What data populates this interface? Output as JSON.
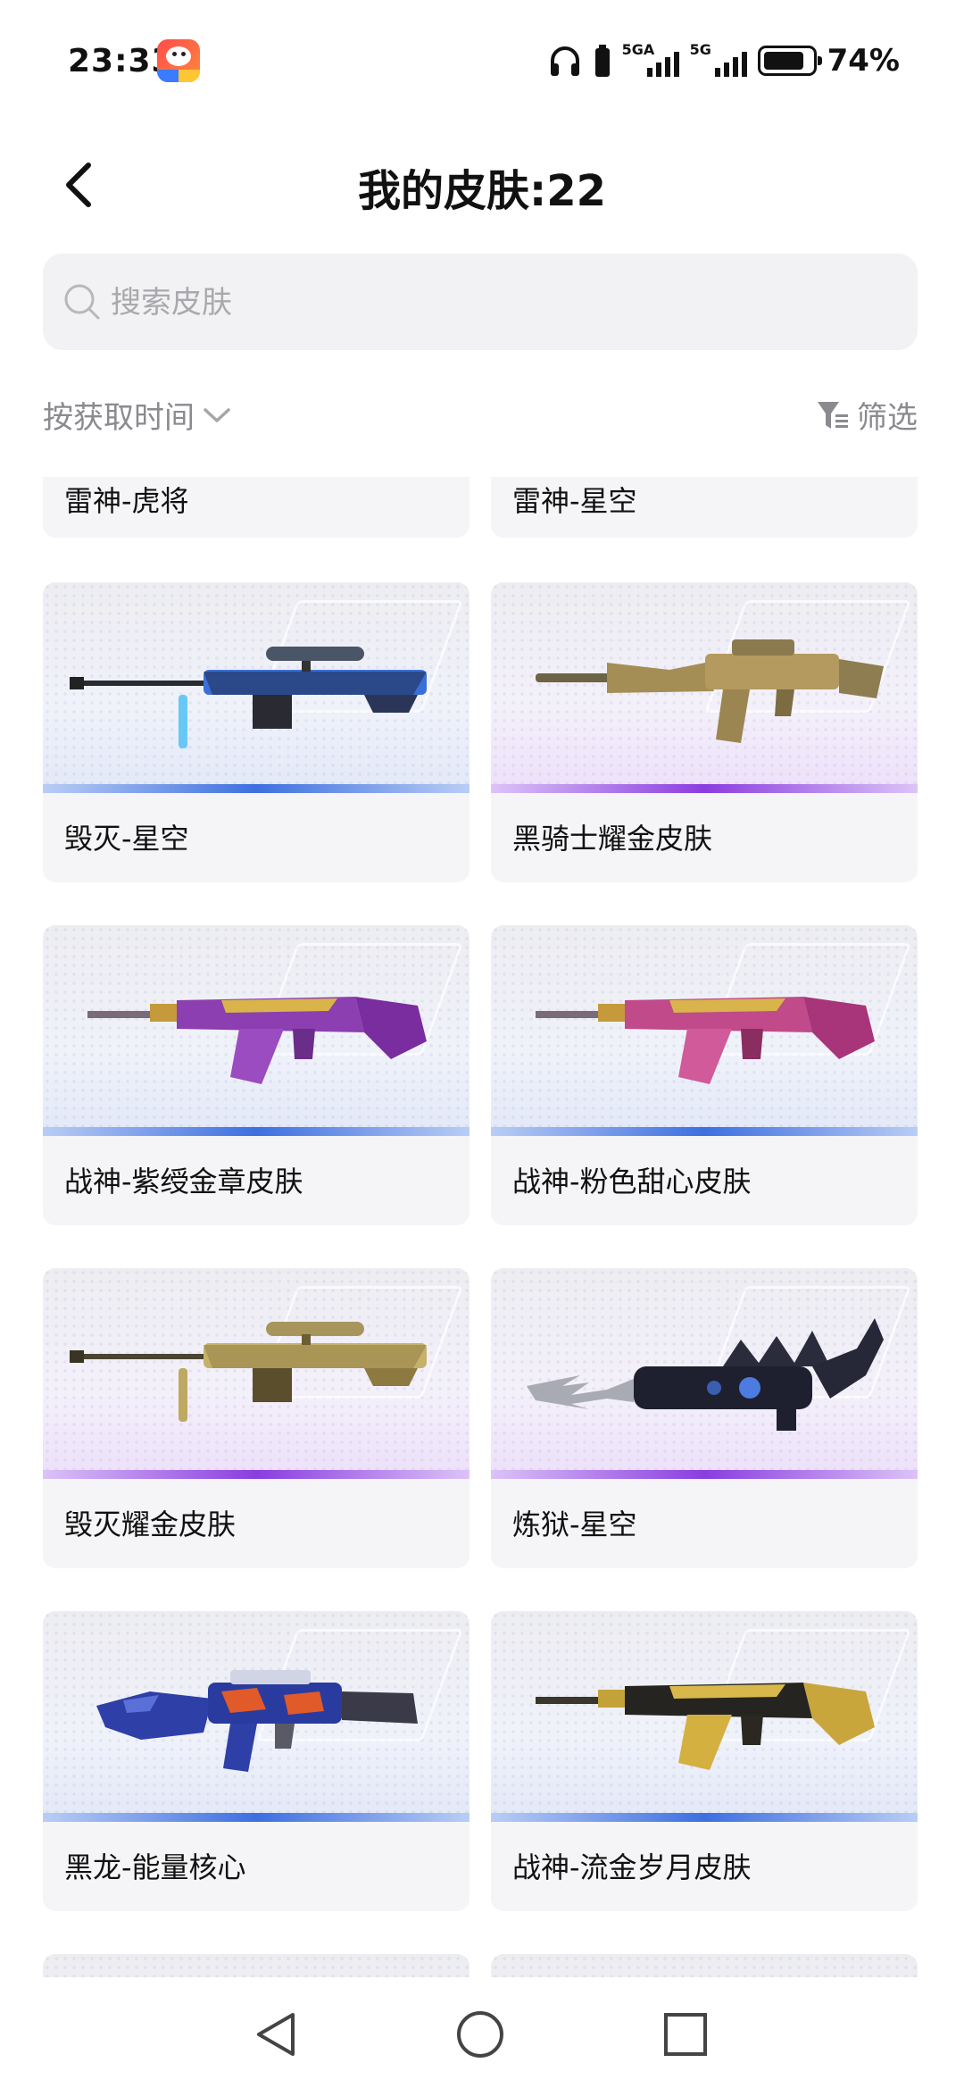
{
  "status_bar": {
    "time": "23:33",
    "network_1": "5GA",
    "network_2": "5G",
    "battery": "74%",
    "icons": [
      "app-notification-icon",
      "headphones-icon",
      "battery-saver-icon",
      "signal-icon",
      "signal-icon",
      "battery-icon"
    ]
  },
  "header": {
    "title": "我的皮肤:22",
    "back_icon": "chevron-left-icon"
  },
  "search": {
    "placeholder": "搜索皮肤",
    "value": ""
  },
  "sort": {
    "label": "按获取时间",
    "icon": "chevron-down-icon"
  },
  "filter": {
    "label": "筛选",
    "icon": "filter-icon"
  },
  "skins": [
    {
      "name": "雷神-虎将",
      "rarity": "partial"
    },
    {
      "name": "雷神-星空",
      "rarity": "partial"
    },
    {
      "name": "毁灭-星空",
      "rarity": "blue",
      "weapon": "sniper-rifle",
      "scheme": "galaxy"
    },
    {
      "name": "黑骑士耀金皮肤",
      "rarity": "purple",
      "weapon": "assault-rifle-m4",
      "scheme": "gold"
    },
    {
      "name": "战神-紫绶金章皮肤",
      "rarity": "blue",
      "weapon": "ak-rifle",
      "scheme": "purple-gold"
    },
    {
      "name": "战神-粉色甜心皮肤",
      "rarity": "blue",
      "weapon": "ak-rifle",
      "scheme": "pink-gold"
    },
    {
      "name": "毁灭耀金皮肤",
      "rarity": "purple",
      "weapon": "sniper-rifle",
      "scheme": "gold"
    },
    {
      "name": "炼狱-星空",
      "rarity": "purple",
      "weapon": "gatling-dragon",
      "scheme": "dark-blue"
    },
    {
      "name": "黑龙-能量核心",
      "rarity": "blue",
      "weapon": "assault-rifle-dragon",
      "scheme": "blue-red"
    },
    {
      "name": "战神-流金岁月皮肤",
      "rarity": "blue",
      "weapon": "ak-rifle",
      "scheme": "black-gold"
    }
  ],
  "colors": {
    "accent_blue": "#3d6fe0",
    "accent_purple": "#8a3de0",
    "card_bg": "#f5f5f7",
    "search_bg": "#f2f2f4",
    "muted_text": "#8a8a8f"
  },
  "nav": {
    "back_icon": "nav-back-icon",
    "home_icon": "nav-home-icon",
    "recents_icon": "nav-recents-icon"
  }
}
